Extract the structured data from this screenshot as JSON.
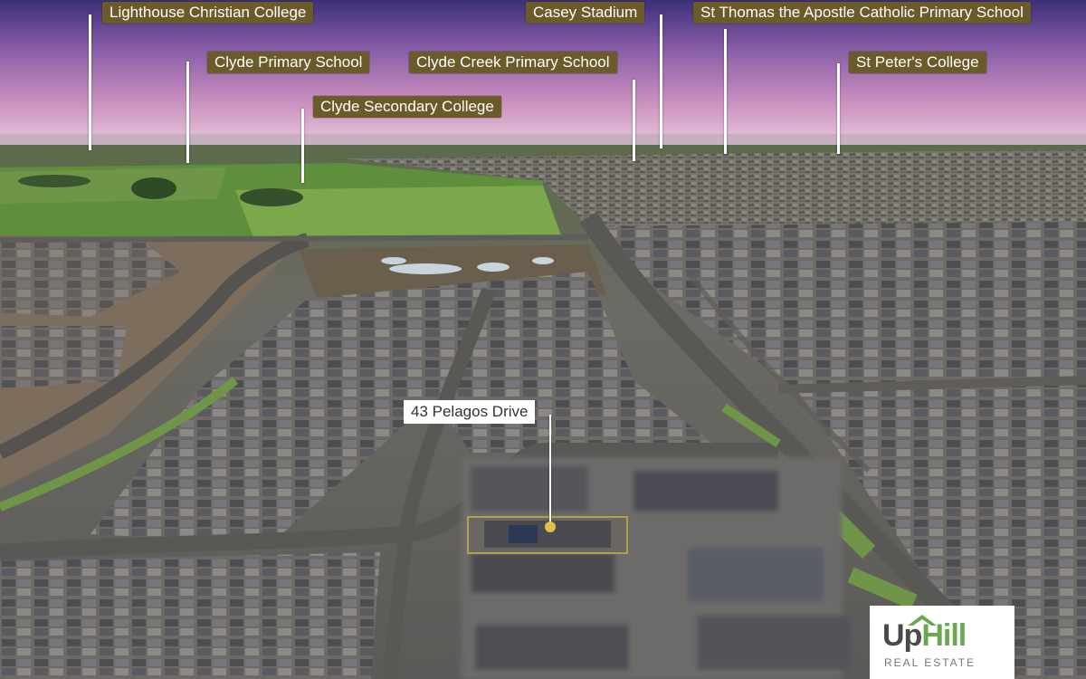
{
  "schools": [
    {
      "name": "Lighthouse Christian College"
    },
    {
      "name": "Clyde Primary School"
    },
    {
      "name": "Clyde Secondary College"
    },
    {
      "name": "Casey Stadium"
    },
    {
      "name": "Clyde Creek Primary School"
    },
    {
      "name": "St Thomas the Apostle Catholic Primary School"
    },
    {
      "name": "St Peter's College"
    }
  ],
  "property": {
    "address": "43 Pelagos Drive"
  },
  "logo": {
    "part1": "Up",
    "part2": "Hill",
    "tagline": "REAL ESTATE"
  },
  "colors": {
    "label_bg": "#6b5a2a",
    "property_outline": "#b5a04a",
    "brand_green": "#6aa84f"
  }
}
